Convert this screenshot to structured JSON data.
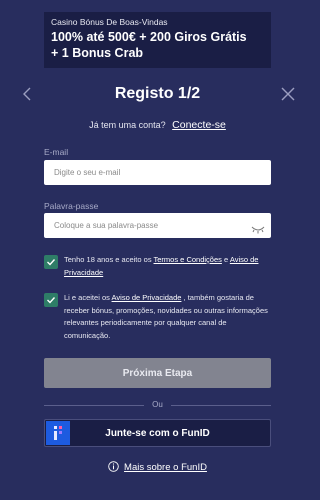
{
  "promo": {
    "subtitle": "Casino Bónus De Boas-Vindas",
    "title_line1": "100% até 500€ + 200 Giros Grátis",
    "title_line2": "+ 1 Bonus Crab"
  },
  "header": {
    "title": "Registo 1/2",
    "back_icon": "chevron-left-icon",
    "close_icon": "close-icon"
  },
  "login": {
    "question": "Já tem uma conta?",
    "link": "Conecte-se"
  },
  "email": {
    "label": "E-mail",
    "placeholder": "Digite o seu e-mail",
    "value": ""
  },
  "password": {
    "label": "Palavra-passe",
    "placeholder": "Coloque a sua palavra-passe",
    "value": ""
  },
  "consent_terms": {
    "checked": true,
    "text_prefix": "Tenho 18 anos e aceito os ",
    "terms_link": "Termos e Condições",
    "text_mid": " e ",
    "privacy_link": "Aviso de Privacidade"
  },
  "consent_marketing": {
    "checked": true,
    "text_prefix": "Li e aceitei os ",
    "privacy_link": "Aviso de Privacidade",
    "text_suffix": " , também gostaria de receber bónus, promoções, novidades ou outras informações relevantes periodicamente por qualquer canal de comunicação."
  },
  "next_button": "Próxima Etapa",
  "divider": "Ou",
  "funid_button": "Junte-se com o FunID",
  "more_about": "Mais sobre o FunID",
  "colors": {
    "background": "#282d5e",
    "promo_bg": "#1a1e45",
    "checkbox": "#2e7d67",
    "disabled_button": "#828490",
    "funid_blue": "#1d5be0"
  }
}
